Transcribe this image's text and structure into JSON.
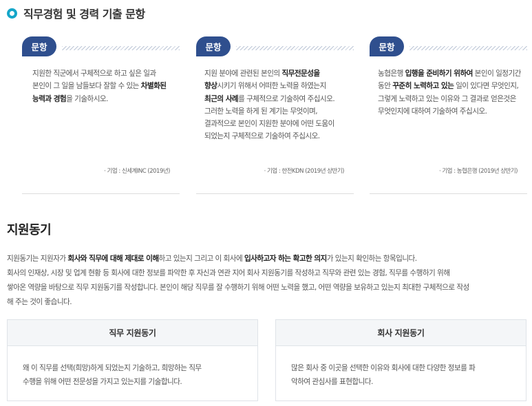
{
  "section_title": "직무경험 및 경력 기출 문항",
  "question_label": "문항",
  "questions": [
    {
      "text_parts": [
        {
          "t": "지원한 직군에서 구체적으로 하고 싶은 일과 본인이 그 일을 남들보다 잘할 수 있는 ",
          "b": false
        },
        {
          "t": "차별화된 능력과 경험",
          "b": true
        },
        {
          "t": "을 기술하시오.",
          "b": false
        }
      ],
      "source": "· 기업 : 신세계INC (2019년)"
    },
    {
      "text_parts": [
        {
          "t": "지원 분야에 관련된 본인의 ",
          "b": false
        },
        {
          "t": "직무전문성을 향상",
          "b": true
        },
        {
          "t": "시키기 위해서 어떠한 노력을 하였는지 ",
          "b": false
        },
        {
          "t": "최근의 사례",
          "b": true
        },
        {
          "t": "를 구체적으로 기술하여 주십시오. 그러한 노력을 하게 된 계기는 무엇이며, 결과적으로 본인이 지원한 분야에 어떤 도움이 되었는지 구체적으로 기술하여 주십시오.",
          "b": false
        }
      ],
      "source": "· 기업 : 한전KDN (2019년 상반기)"
    },
    {
      "text_parts": [
        {
          "t": "농협은행 ",
          "b": false
        },
        {
          "t": "입행을 준비하기 위하여",
          "b": true
        },
        {
          "t": " 본인이 일정기간 동안 ",
          "b": false
        },
        {
          "t": "꾸준히 노력하고 있는",
          "b": true
        },
        {
          "t": " 일이 있다면 무엇인지, 그렇게 노력하고 있는 이유와 그 결과로 얻은것은 무엇인지에 대하여 기술하여 주십시오.",
          "b": false
        }
      ],
      "source": "· 기업 : 농협은행 (2019년 상반기)"
    }
  ],
  "motivation": {
    "title": "지원동기",
    "intro_parts": [
      {
        "t": "지원동기는 지원자가 ",
        "b": false
      },
      {
        "t": "회사와 직무에 대해 제대로 이해",
        "b": true
      },
      {
        "t": "하고 있는지 그리고 이 회사에 ",
        "b": false
      },
      {
        "t": "입사하고자 하는 확고한 의지",
        "b": true
      },
      {
        "t": "가 있는지 확인하는 항목입니다.",
        "b": false
      },
      {
        "br": true
      },
      {
        "t": "회사의 인재상, 시장 및 업계 현황 등 회사에 대한 정보를 파악한 후 자신과 연관 지어 회사 지원동기를 작성하고 직무와 관련 있는 경험, 직무를 수행하기 위해",
        "b": false
      },
      {
        "br": true
      },
      {
        "t": "쌓아온 역량을 바탕으로 직무 지원동기를 작성합니다. 본인이 해당 직무를 잘 수행하기 위해 어떤 노력을 했고, 어떤 역량을 보유하고 있는지 최대한 구체적으로 작성",
        "b": false
      },
      {
        "br": true
      },
      {
        "t": "해 주는 것이 좋습니다.",
        "b": false
      }
    ],
    "boxes": [
      {
        "title": "직무 지원동기",
        "lines": [
          "왜 이 직무를 선택(희망)하게 되었는지 기술하고, 희망하는 직무",
          "수행을 위해 어떤 전문성을 가지고 있는지를 기술합니다."
        ]
      },
      {
        "title": "회사 지원동기",
        "lines": [
          "많은 회사 중 이곳을 선택한 이유와 회사에 대한 다양한 정보를 파",
          "악하여 관심사를 표현합니다."
        ]
      }
    ]
  },
  "colors": {
    "accent": "#15a6c9",
    "pill": "#2f4f8e",
    "box_header_bg": "#f4f6f8"
  }
}
